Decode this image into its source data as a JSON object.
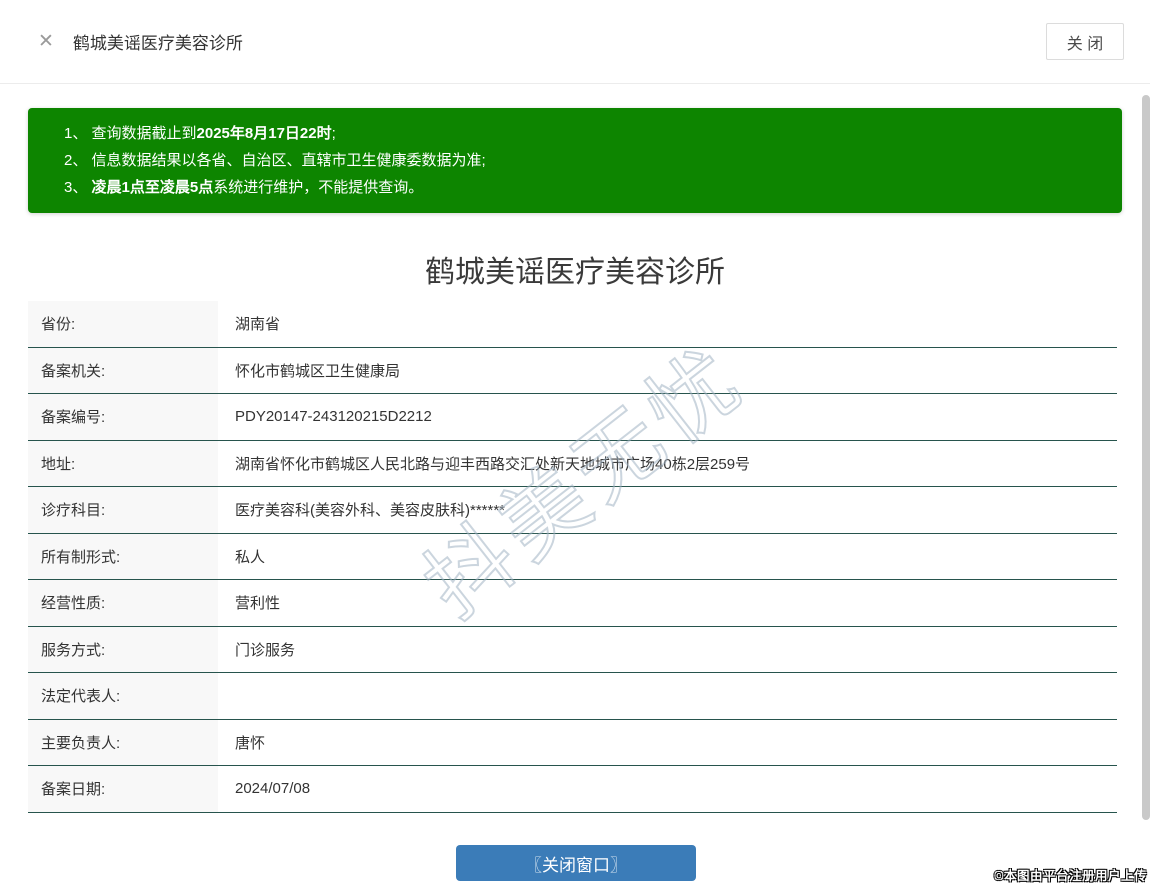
{
  "icons": {
    "close_x": "✕"
  },
  "topbar": {
    "title": "鹤城美谣医疗美容诊所",
    "close_button_label": "关 闭"
  },
  "notice": {
    "background_color": "#0d8500",
    "lines": [
      {
        "pre": "1、 查询数据截止到",
        "bold": "2025年8月17日22时",
        "post": ";"
      },
      {
        "pre": "2、 信息数据结果以各省、自治区、直辖市卫生健康委数据为准;",
        "bold": "",
        "post": ""
      },
      {
        "pre": "3、 ",
        "bold": "凌晨1点至凌晨5点",
        "post": "系统进行维护，不能提供查询。"
      }
    ]
  },
  "page_title": "鹤城美谣医疗美容诊所",
  "table": {
    "divider_color": "#27544d",
    "label_bg_color": "#f8f8f8",
    "rows": [
      {
        "label": "省份:",
        "value": "湖南省"
      },
      {
        "label": "备案机关:",
        "value": "怀化市鹤城区卫生健康局"
      },
      {
        "label": "备案编号:",
        "value": "PDY20147-243120215D2212"
      },
      {
        "label": "地址:",
        "value": "湖南省怀化市鹤城区人民北路与迎丰西路交汇处新天地城市广场40栋2层259号"
      },
      {
        "label": "诊疗科目:",
        "value": "医疗美容科(美容外科、美容皮肤科)******"
      },
      {
        "label": "所有制形式:",
        "value": "私人"
      },
      {
        "label": "经营性质:",
        "value": "营利性"
      },
      {
        "label": "服务方式:",
        "value": "门诊服务"
      },
      {
        "label": "法定代表人:",
        "value": ""
      },
      {
        "label": "主要负责人:",
        "value": "唐怀"
      },
      {
        "label": "备案日期:",
        "value": "2024/07/08"
      }
    ]
  },
  "watermark_text": "抖美无忧",
  "footer": {
    "close_window_button_label": "〖关闭窗口〗",
    "button_color": "#3b7cb8",
    "corner_copyright": "©本图由平台注册用户上传"
  }
}
